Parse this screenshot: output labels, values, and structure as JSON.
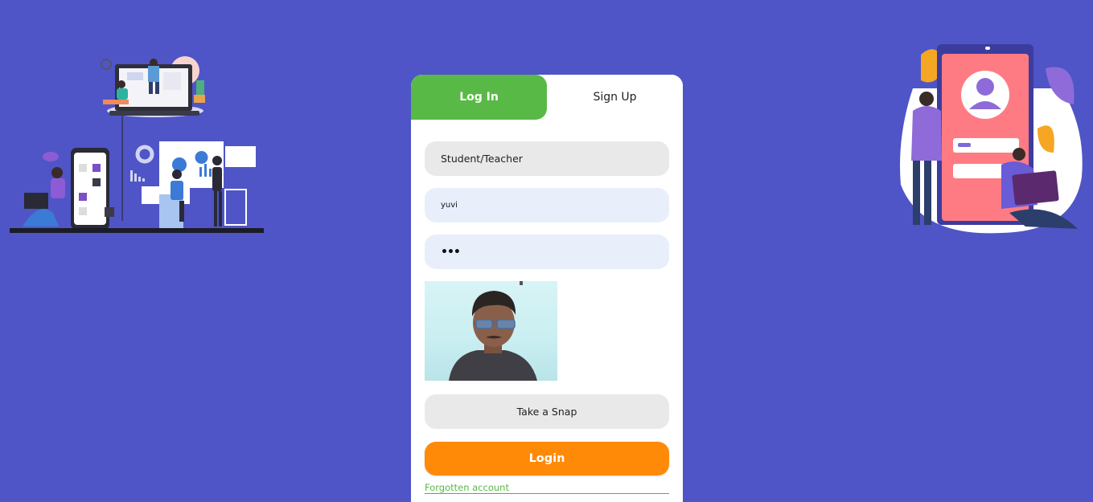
{
  "tabs": {
    "login_label": "Log In",
    "signup_label": "Sign Up"
  },
  "form": {
    "role_select": "Student/Teacher",
    "username_value": "yuvi",
    "password_value": "•••",
    "snap_button": "Take a Snap",
    "login_button": "Login",
    "forgot_link": "Forgotten account"
  },
  "colors": {
    "background": "#4f55c6",
    "active_tab": "#59b946",
    "login_button": "#ff8a08"
  },
  "icons": {
    "left_illustration": "online-learning-illustration",
    "right_illustration": "user-login-illustration",
    "camera_preview": "webcam-preview"
  }
}
